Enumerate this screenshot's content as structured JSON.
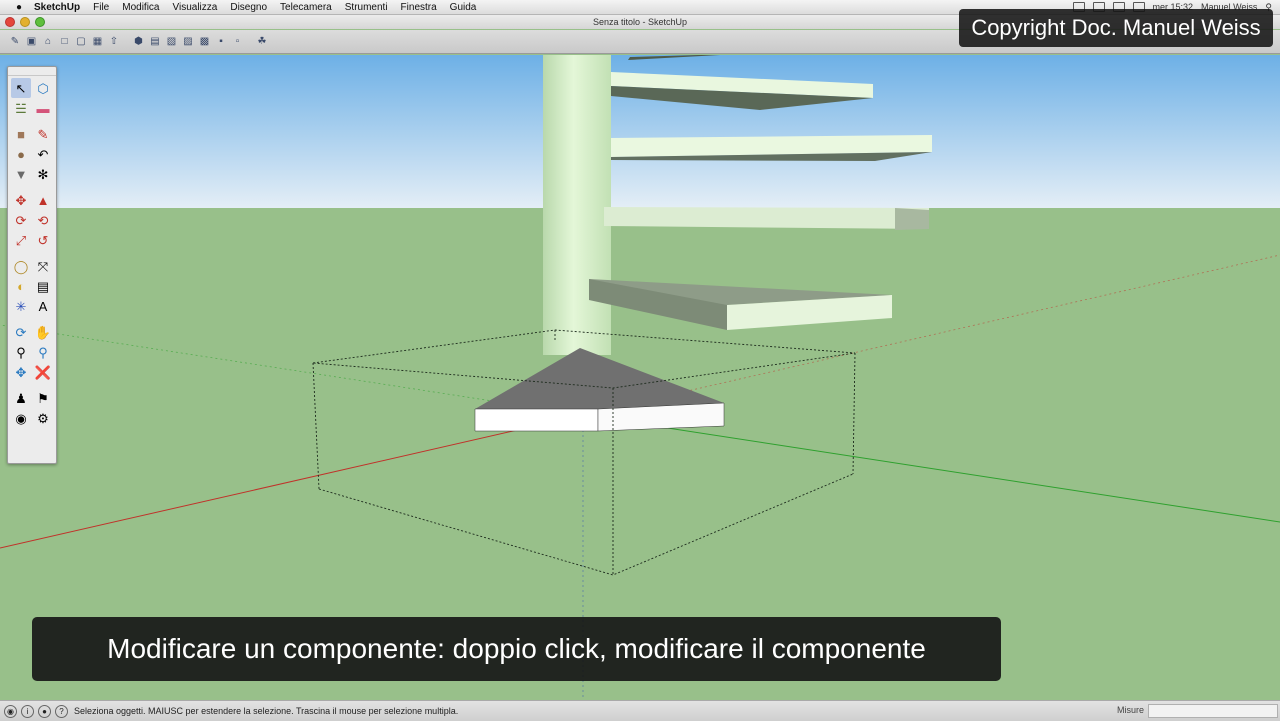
{
  "menubar": {
    "app": "SketchUp",
    "items": [
      "File",
      "Modifica",
      "Visualizza",
      "Disegno",
      "Telecamera",
      "Strumenti",
      "Finestra",
      "Guida"
    ],
    "clock": "mer 15:32",
    "user": "Manuel Weiss"
  },
  "window": {
    "title": "Senza titolo - SketchUp"
  },
  "toolbar": {
    "buttons": [
      "walk-icon",
      "hand-icon",
      "home-icon",
      "save-icon",
      "cut-icon",
      "copy-icon",
      "paste-icon",
      "iso-view-icon",
      "top-view-icon",
      "front-view-icon",
      "right-view-icon",
      "back-view-icon",
      "left-view-icon",
      "bottom-view-icon",
      "extension-icon"
    ]
  },
  "overlay": {
    "copyright": "Copyright Doc. Manuel Weiss",
    "subtitle": "Modificare un componente: doppio click, modificare il componente"
  },
  "palette": {
    "tools": [
      "select-icon",
      "component-icon",
      "paint-bucket-icon",
      "eraser-icon",
      "rectangle-icon",
      "pencil-icon",
      "circle-icon",
      "arc-icon",
      "polygon-icon",
      "freehand-icon",
      "move-icon",
      "push-pull-icon",
      "rotate-icon",
      "follow-me-icon",
      "scale-icon",
      "offset-icon",
      "tape-measure-icon",
      "dimension-icon",
      "protractor-icon",
      "text-icon",
      "axes-icon",
      "3d-text-icon",
      "orbit-icon",
      "pan-icon",
      "zoom-icon",
      "zoom-window-icon",
      "zoom-extents-icon",
      "previous-view-icon",
      "position-camera-icon",
      "footprints-icon",
      "look-around-icon",
      "section-plane-icon"
    ],
    "selected": "select-icon"
  },
  "status": {
    "text": "Seleziona oggetti. MAIUSC per estendere la selezione. Trascina il mouse per selezione multipla.",
    "measure_label": "Misure",
    "measure_value": ""
  },
  "colors": {
    "sky_top": "#6db0e6",
    "sky_bottom": "#e4eef6",
    "ground": "#98c08a",
    "step_face": "#eef9e4",
    "column": "#d6f0c8",
    "selection": "#1c2a1c",
    "axis_red": "#c0322a",
    "axis_green": "#2ea02e"
  }
}
